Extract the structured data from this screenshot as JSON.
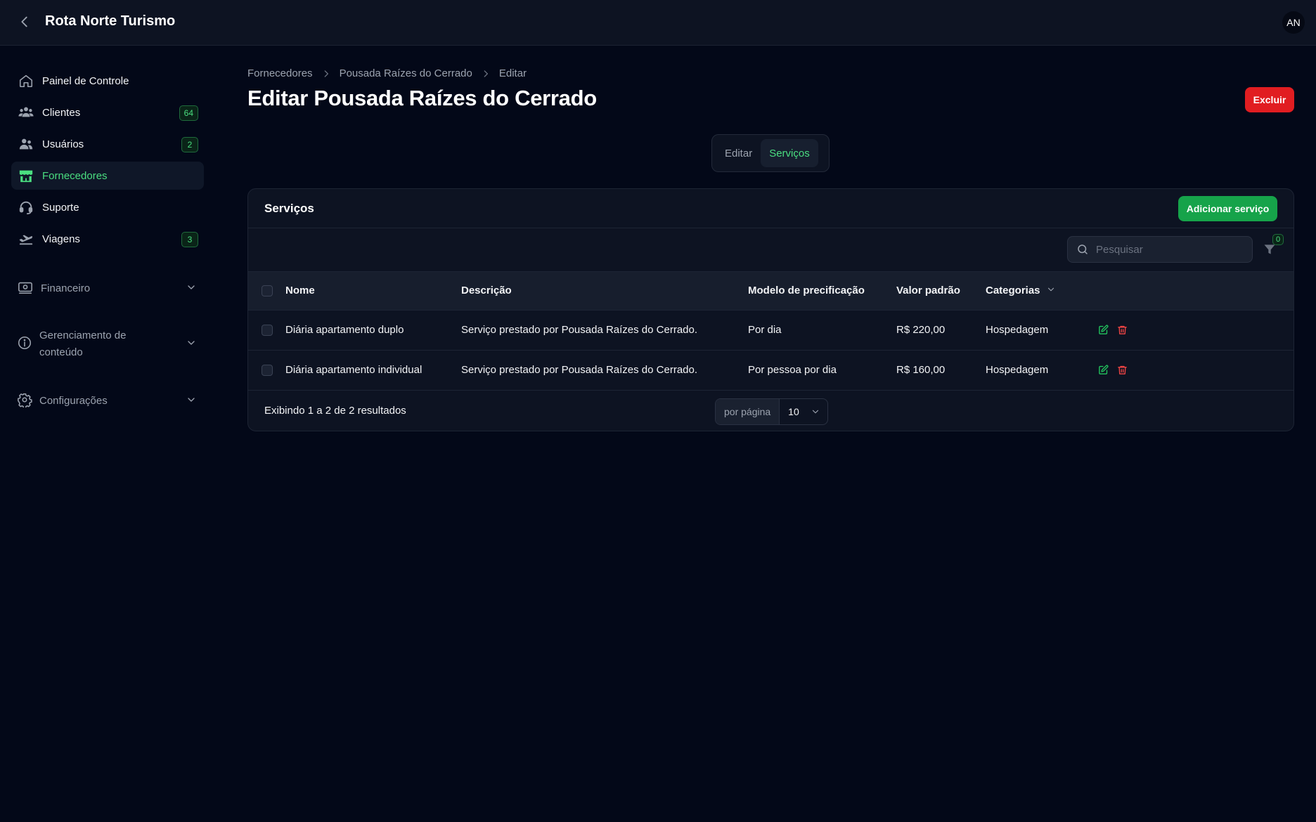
{
  "app": {
    "title": "Rota Norte Turismo",
    "avatar_initials": "AN"
  },
  "sidebar": {
    "items": [
      {
        "label": "Painel de Controle",
        "icon": "home-icon",
        "badge": ""
      },
      {
        "label": "Clientes",
        "icon": "users-group-icon",
        "badge": "64"
      },
      {
        "label": "Usuários",
        "icon": "users-icon",
        "badge": "2"
      },
      {
        "label": "Fornecedores",
        "icon": "storefront-icon",
        "badge": "",
        "active": true
      },
      {
        "label": "Suporte",
        "icon": "headset-icon",
        "badge": ""
      },
      {
        "label": "Viagens",
        "icon": "airplane-icon",
        "badge": "3"
      }
    ],
    "groups": [
      {
        "label": "Financeiro",
        "icon": "banknote-icon"
      },
      {
        "label": "Gerenciamento de conteúdo",
        "icon": "info-icon"
      },
      {
        "label": "Configurações",
        "icon": "gear-icon"
      }
    ]
  },
  "breadcrumb": {
    "items": [
      "Fornecedores",
      "Pousada Raízes do Cerrado",
      "Editar"
    ]
  },
  "page": {
    "title": "Editar Pousada Raízes do Cerrado",
    "delete_label": "Excluir"
  },
  "tabs": [
    {
      "label": "Editar",
      "active": false
    },
    {
      "label": "Serviços",
      "active": true
    }
  ],
  "services": {
    "title": "Serviços",
    "add_label": "Adicionar serviço",
    "search_placeholder": "Pesquisar",
    "filter_count": "0",
    "columns": [
      "Nome",
      "Descrição",
      "Modelo de precificação",
      "Valor padrão",
      "Categorias"
    ],
    "rows": [
      {
        "nome": "Diária apartamento duplo",
        "descricao": "Serviço prestado por Pousada Raízes do Cerrado.",
        "modelo": "Por dia",
        "valor": "R$ 220,00",
        "categoria": "Hospedagem"
      },
      {
        "nome": "Diária apartamento individual",
        "descricao": "Serviço prestado por Pousada Raízes do Cerrado.",
        "modelo": "Por pessoa por dia",
        "valor": "R$ 160,00",
        "categoria": "Hospedagem"
      }
    ],
    "result_text": "Exibindo 1 a 2 de 2 resultados",
    "per_page_label": "por página",
    "per_page_value": "10"
  },
  "colors": {
    "accent": "#4ade80",
    "danger": "#e11d21",
    "primary_button": "#16a34a",
    "background": "#030818"
  }
}
